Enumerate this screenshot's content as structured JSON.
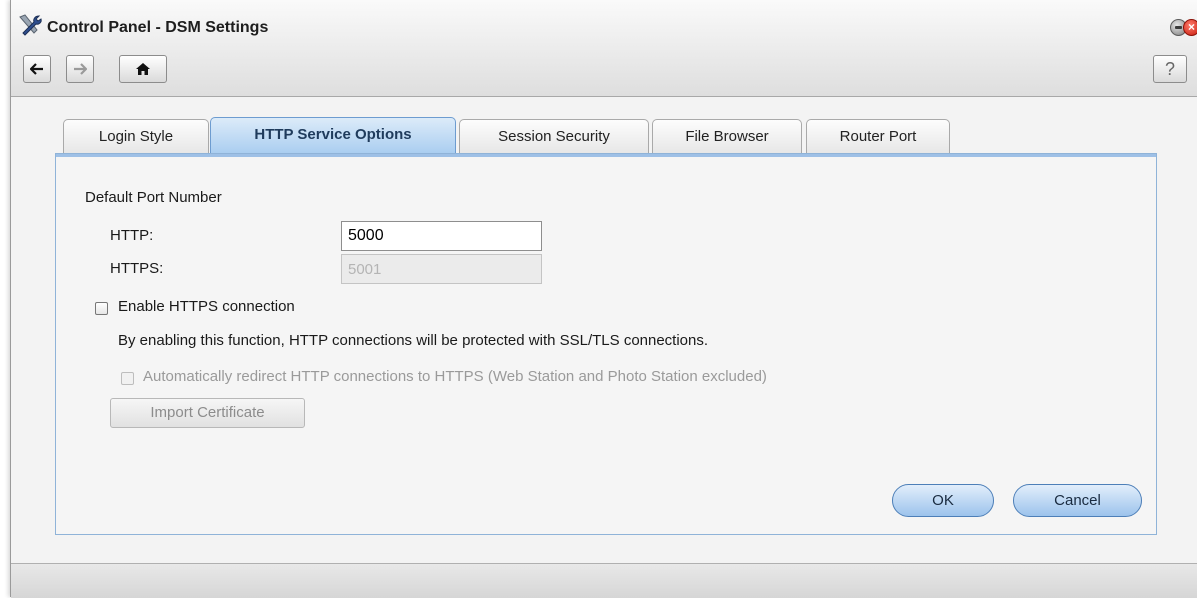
{
  "window": {
    "title": "Control Panel - DSM Settings",
    "close_glyph": "×"
  },
  "toolbar": {
    "help_label": "?",
    "icons": [
      "back-arrow-icon",
      "forward-arrow-icon",
      "home-icon"
    ]
  },
  "tabs": [
    {
      "label": "Login Style",
      "active": false
    },
    {
      "label": "HTTP Service Options",
      "active": true
    },
    {
      "label": "Session Security",
      "active": false
    },
    {
      "label": "File Browser",
      "active": false
    },
    {
      "label": "Router Port",
      "active": false
    }
  ],
  "form": {
    "section_heading": "Default Port Number",
    "http_label": "HTTP:",
    "http_value": "5000",
    "https_label": "HTTPS:",
    "https_value": "5001",
    "enable_https_label": "Enable HTTPS connection",
    "enable_https_checked": false,
    "https_description": "By enabling this function, HTTP connections will be protected with SSL/TLS connections.",
    "auto_redirect_label": "Automatically redirect HTTP connections to HTTPS (Web Station and Photo Station excluded)",
    "auto_redirect_checked": false,
    "import_certificate_label": "Import Certificate"
  },
  "actions": {
    "ok_label": "OK",
    "cancel_label": "Cancel"
  },
  "colors": {
    "active_tab": "#a9cdf0",
    "close_button": "#c61a0c",
    "panel_border": "#8fb3d8"
  }
}
